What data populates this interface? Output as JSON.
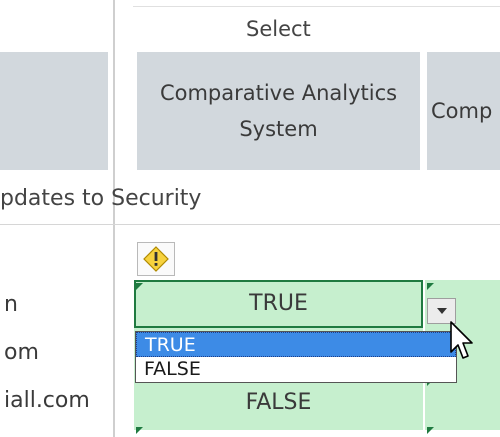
{
  "header": {
    "select_label": "Select",
    "column_main": "Comparative Analytics System",
    "column_next_partial": "Comp"
  },
  "section": {
    "text": "pdates to Security"
  },
  "rows": [
    {
      "label_partial": "n"
    },
    {
      "label_partial": "om"
    },
    {
      "label_partial": "iall.com"
    }
  ],
  "cells": {
    "active_value": "TRUE",
    "row3_value": "FALSE"
  },
  "dropdown": {
    "options": [
      "TRUE",
      "FALSE"
    ],
    "selected": "TRUE"
  },
  "icons": {
    "warning": "warning-diamond-icon",
    "dropdown_arrow": "chevron-down-icon",
    "cursor": "mouse-pointer-icon",
    "error_indicator": "green-triangle-indicator"
  },
  "colors": {
    "header_fill": "#d2d8dd",
    "cell_green": "#c6efce",
    "selection_blue": "#3d8be6",
    "active_border": "#1f7a40"
  }
}
